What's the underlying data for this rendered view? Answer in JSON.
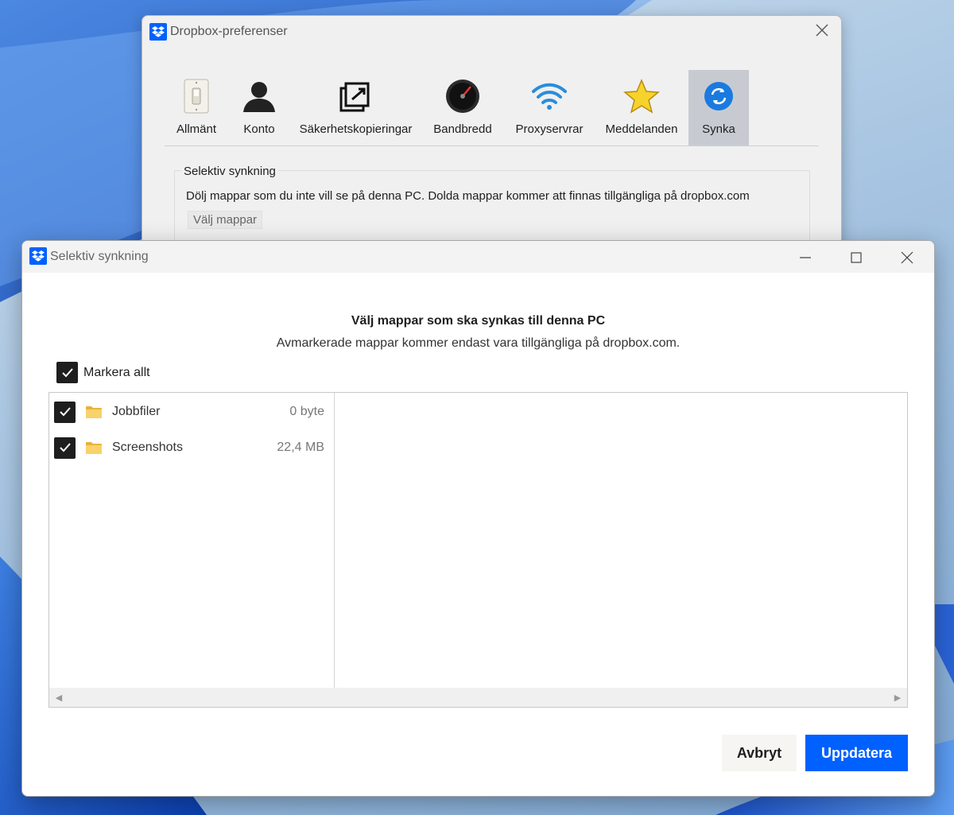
{
  "preferences_window": {
    "title": "Dropbox-preferenser",
    "tabs": [
      {
        "label": "Allmänt",
        "icon": "light-switch-icon",
        "active": false
      },
      {
        "label": "Konto",
        "icon": "person-icon",
        "active": false
      },
      {
        "label": "Säkerhetskopieringar",
        "icon": "backup-icon",
        "active": false
      },
      {
        "label": "Bandbredd",
        "icon": "speedometer-icon",
        "active": false
      },
      {
        "label": "Proxyservrar",
        "icon": "wifi-icon",
        "active": false
      },
      {
        "label": "Meddelanden",
        "icon": "star-icon",
        "active": false
      },
      {
        "label": "Synka",
        "icon": "sync-icon",
        "active": true
      }
    ],
    "group_title": "Selektiv synkning",
    "group_description": "Dölj mappar som du inte vill se på denna PC. Dolda mappar kommer att finnas tillgängliga på dropbox.com",
    "choose_folders_label": "Välj mappar"
  },
  "dialog": {
    "title": "Selektiv synkning",
    "heading": "Välj mappar som ska synkas till denna PC",
    "subheading": "Avmarkerade mappar kommer endast vara tillgängliga på dropbox.com.",
    "select_all_label": "Markera allt",
    "select_all_checked": true,
    "folders": [
      {
        "name": "Jobbfiler",
        "size": "0 byte",
        "checked": true
      },
      {
        "name": "Screenshots",
        "size": "22,4 MB",
        "checked": true
      }
    ],
    "cancel_label": "Avbryt",
    "update_label": "Uppdatera"
  },
  "colors": {
    "accent": "#0061fe",
    "active_tab": "#c7cbd1",
    "checkbox": "#1e1e1e",
    "folder": "#f5c542"
  }
}
